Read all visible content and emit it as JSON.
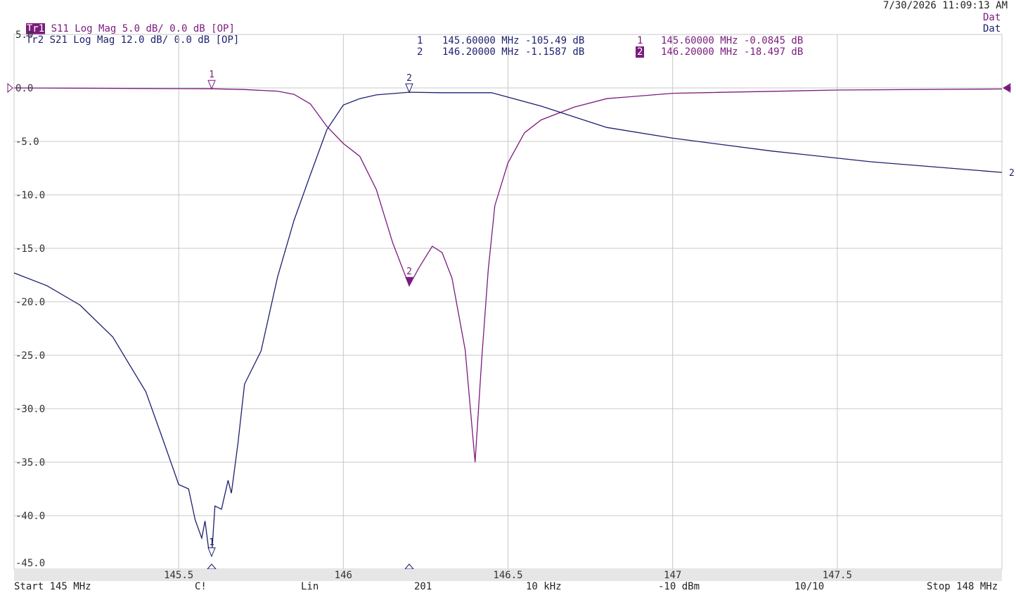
{
  "header": {
    "timestamp": "7/30/2026 11:09:13 AM",
    "trace1": {
      "badge": "Tr1",
      "text": "S11 Log Mag 5.0 dB/ 0.0 dB [OP]",
      "status": "Dat"
    },
    "trace2": {
      "badge": "Tr2",
      "text": "S21 Log Mag 12.0 dB/ 0.0 dB [OP]",
      "status": "Dat"
    }
  },
  "markers": {
    "s21": [
      {
        "id": "1",
        "text": "145.60000 MHz -105.49 dB"
      },
      {
        "id": "2",
        "text": "146.20000 MHz -1.1587 dB"
      }
    ],
    "s11": [
      {
        "id": "1",
        "text": "145.60000 MHz -0.0845 dB"
      },
      {
        "id": "2",
        "text": "146.20000 MHz -18.497 dB",
        "active": true
      }
    ]
  },
  "footer": {
    "start": "Start 145 MHz",
    "marker_flag": "C!",
    "scale": "Lin",
    "points": "201",
    "ifbw": "10 kHz",
    "power": "-10 dBm",
    "avg": "10/10",
    "stop": "Stop 148 MHz"
  },
  "colors": {
    "s11": "#7b1b7e",
    "s21": "#1c1f6e",
    "grid": "#c8c8c8"
  },
  "chart_data": {
    "type": "line",
    "xlim": [
      145,
      148
    ],
    "ylim": [
      -45,
      5
    ],
    "x_ticks": [
      145.5,
      146,
      146.5,
      147,
      147.5
    ],
    "x_tick_labels": [
      "145.5",
      "146",
      "146.5",
      "147",
      "147.5"
    ],
    "y_ticks": [
      5,
      0,
      -5,
      -10,
      -15,
      -20,
      -25,
      -30,
      -35,
      -40,
      -45
    ],
    "y_tick_labels": [
      "5.0",
      "0.0",
      "-5.0",
      "-10.0",
      "-15.0",
      "-20.0",
      "-25.0",
      "-30.0",
      "-35.0",
      "-40.0",
      "-45.0"
    ],
    "grid": true,
    "series": [
      {
        "name": "S11",
        "color": "#7b1b7e",
        "x": [
          145.0,
          145.4,
          145.6,
          145.7,
          145.8,
          145.85,
          145.9,
          145.95,
          146.0,
          146.05,
          146.1,
          146.15,
          146.2,
          146.23,
          146.27,
          146.3,
          146.33,
          146.37,
          146.4,
          146.42,
          146.44,
          146.46,
          146.5,
          146.55,
          146.6,
          146.7,
          146.8,
          147.0,
          147.5,
          148.0
        ],
        "y": [
          0.0,
          -0.05,
          -0.08,
          -0.15,
          -0.3,
          -0.6,
          -1.5,
          -3.6,
          -5.2,
          -6.4,
          -9.5,
          -14.5,
          -18.5,
          -16.8,
          -14.8,
          -15.4,
          -17.8,
          -24.5,
          -35.0,
          -25.5,
          -17.0,
          -11.0,
          -7.0,
          -4.2,
          -3.0,
          -1.8,
          -1.0,
          -0.5,
          -0.2,
          -0.1
        ]
      },
      {
        "name": "S21",
        "color": "#1c1f6e",
        "x": [
          145.0,
          145.1,
          145.2,
          145.3,
          145.4,
          145.45,
          145.5,
          145.53,
          145.55,
          145.57,
          145.58,
          145.59,
          145.6,
          145.61,
          145.63,
          145.65,
          145.66,
          145.68,
          145.7,
          145.75,
          145.8,
          145.85,
          145.9,
          145.95,
          146.0,
          146.05,
          146.1,
          146.2,
          146.3,
          146.45,
          146.6,
          146.8,
          147.0,
          147.3,
          147.6,
          148.0
        ],
        "y": [
          -17.3,
          -18.5,
          -20.3,
          -23.3,
          -28.4,
          -32.7,
          -37.1,
          -37.5,
          -40.4,
          -42.1,
          -40.5,
          -42.9,
          -43.8,
          -39.1,
          -39.4,
          -36.7,
          -37.9,
          -33.2,
          -27.7,
          -24.6,
          -17.7,
          -12.4,
          -8.1,
          -3.9,
          -1.6,
          -1.0,
          -0.65,
          -0.4,
          -0.45,
          -0.45,
          -1.7,
          -3.7,
          -4.7,
          -5.9,
          -6.9,
          -7.9
        ]
      }
    ],
    "marker_points": [
      {
        "series": "S11",
        "id": "1",
        "x": 145.6,
        "y": -0.08
      },
      {
        "series": "S11",
        "id": "2",
        "x": 146.2,
        "y": -18.5
      },
      {
        "series": "S21",
        "id": "1",
        "x": 145.6,
        "y": -43.8
      },
      {
        "series": "S21",
        "id": "2",
        "x": 146.2,
        "y": -0.4
      }
    ]
  }
}
